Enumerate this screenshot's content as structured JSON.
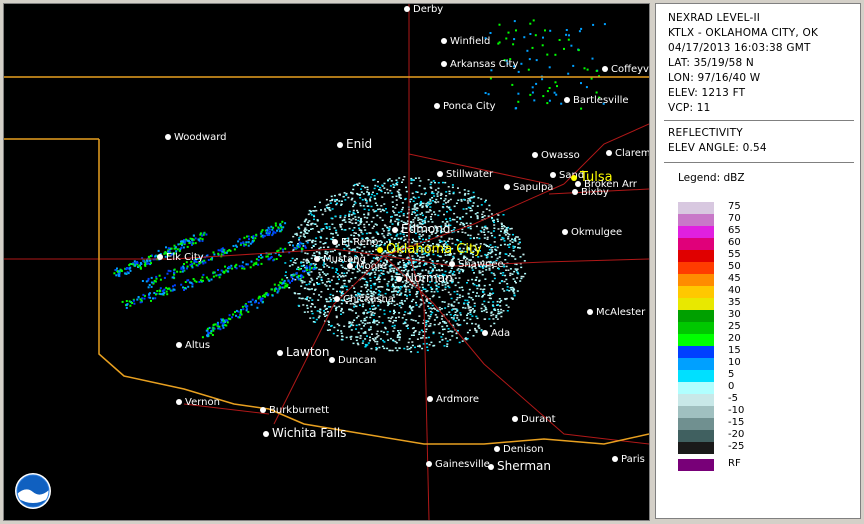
{
  "header": {
    "product": "NEXRAD LEVEL-II",
    "station": "KTLX - OKLAHOMA CITY, OK",
    "datetime": "04/17/2013 16:03:38 GMT",
    "lat": "LAT: 35/19/58 N",
    "lon": "LON: 97/16/40 W",
    "elev": "ELEV: 1213 FT",
    "vcp": "VCP: 11",
    "mode": "REFLECTIVITY",
    "elev_angle": "ELEV ANGLE: 0.54"
  },
  "legend": {
    "title": "Legend: dBZ",
    "levels": [
      {
        "label": "75",
        "color": "#d8c8e0"
      },
      {
        "label": "70",
        "color": "#c878c8"
      },
      {
        "label": "65",
        "color": "#e020e0"
      },
      {
        "label": "60",
        "color": "#e0007a"
      },
      {
        "label": "55",
        "color": "#e00000"
      },
      {
        "label": "50",
        "color": "#ff3c00"
      },
      {
        "label": "45",
        "color": "#ff8c00"
      },
      {
        "label": "40",
        "color": "#ffc800"
      },
      {
        "label": "35",
        "color": "#e8e800"
      },
      {
        "label": "30",
        "color": "#00a000"
      },
      {
        "label": "25",
        "color": "#00c800"
      },
      {
        "label": "20",
        "color": "#00ff00"
      },
      {
        "label": "15",
        "color": "#0040ff"
      },
      {
        "label": "10",
        "color": "#00a0ff"
      },
      {
        "label": "5",
        "color": "#00e0ff"
      },
      {
        "label": "0",
        "color": "#b0ffff"
      },
      {
        "label": "-5",
        "color": "#c8e8e8"
      },
      {
        "label": "-10",
        "color": "#a0c0c0"
      },
      {
        "label": "-15",
        "color": "#709090"
      },
      {
        "label": "-20",
        "color": "#406060"
      },
      {
        "label": "-25",
        "color": "#1a1a1a"
      }
    ],
    "rf": {
      "label": "RF",
      "color": "#780078"
    }
  },
  "map": {
    "cities": [
      {
        "name": "Derby",
        "cls": ""
      },
      {
        "name": "Winfield",
        "cls": ""
      },
      {
        "name": "Arkansas City",
        "cls": ""
      },
      {
        "name": "Coffeyv",
        "cls": ""
      },
      {
        "name": "Bartlesville",
        "cls": ""
      },
      {
        "name": "Ponca City",
        "cls": ""
      },
      {
        "name": "Woodward",
        "cls": ""
      },
      {
        "name": "Enid",
        "cls": "big"
      },
      {
        "name": "Owasso",
        "cls": ""
      },
      {
        "name": "Claremo",
        "cls": ""
      },
      {
        "name": "Stillwater",
        "cls": ""
      },
      {
        "name": "Sand",
        "cls": ""
      },
      {
        "name": "Tulsa",
        "cls": "radar"
      },
      {
        "name": "Broken Arr",
        "cls": ""
      },
      {
        "name": "Sapulpa",
        "cls": ""
      },
      {
        "name": "Bixby",
        "cls": ""
      },
      {
        "name": "Edmond",
        "cls": "big"
      },
      {
        "name": "El Reno",
        "cls": ""
      },
      {
        "name": "Oklahoma City",
        "cls": "radar"
      },
      {
        "name": "Okmulgee",
        "cls": ""
      },
      {
        "name": "Elk City",
        "cls": ""
      },
      {
        "name": "Mustang",
        "cls": ""
      },
      {
        "name": "Moore",
        "cls": ""
      },
      {
        "name": "Shawnee",
        "cls": ""
      },
      {
        "name": "Norman",
        "cls": "big"
      },
      {
        "name": "Chickasha",
        "cls": ""
      },
      {
        "name": "McAlester",
        "cls": ""
      },
      {
        "name": "Altus",
        "cls": ""
      },
      {
        "name": "Lawton",
        "cls": "big"
      },
      {
        "name": "Ada",
        "cls": ""
      },
      {
        "name": "Duncan",
        "cls": ""
      },
      {
        "name": "Vernon",
        "cls": ""
      },
      {
        "name": "Ardmore",
        "cls": ""
      },
      {
        "name": "Burkburnett",
        "cls": ""
      },
      {
        "name": "Durant",
        "cls": ""
      },
      {
        "name": "Wichita Falls",
        "cls": "big"
      },
      {
        "name": "Denison",
        "cls": ""
      },
      {
        "name": "Gainesville",
        "cls": ""
      },
      {
        "name": "Sherman",
        "cls": "big"
      },
      {
        "name": "Paris",
        "cls": ""
      }
    ]
  },
  "logo": "noaa-logo"
}
